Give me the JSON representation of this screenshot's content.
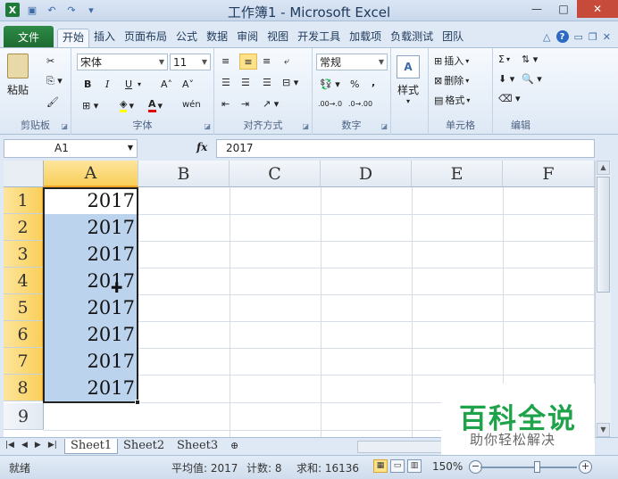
{
  "window": {
    "title": "工作簿1 - Microsoft Excel",
    "minimize": "—",
    "maximize": "□",
    "close": "✕"
  },
  "qat": {
    "app_icon": "X"
  },
  "ribbon_tabs": {
    "file": "文件",
    "items": [
      "开始",
      "插入",
      "页面布局",
      "公式",
      "数据",
      "审阅",
      "视图",
      "开发工具",
      "加载项",
      "负载测试",
      "团队"
    ],
    "help": "?"
  },
  "clipboard": {
    "paste": "粘贴",
    "label": "剪贴板"
  },
  "font": {
    "name": "宋体",
    "size": "11",
    "label": "字体",
    "bold": "B",
    "italic": "I",
    "underline": "U",
    "grow": "A˄",
    "shrink": "A˅",
    "phonetic": "wén"
  },
  "alignment": {
    "label": "对齐方式"
  },
  "number": {
    "format": "常规",
    "label": "数字",
    "percent": "%",
    "comma": ",",
    "inc_decimal": ".00→.0",
    "dec_decimal": ".0→.00"
  },
  "styles": {
    "label": "样式"
  },
  "cells": {
    "insert": "插入",
    "delete": "删除",
    "format": "格式",
    "label": "单元格"
  },
  "editing": {
    "label": "编辑",
    "sum": "Σ"
  },
  "formula_bar": {
    "name_box": "A1",
    "fx": "fx",
    "formula": "2017"
  },
  "grid": {
    "columns": [
      "A",
      "B",
      "C",
      "D",
      "E",
      "F"
    ],
    "rows": [
      "1",
      "2",
      "3",
      "4",
      "5",
      "6",
      "7",
      "8",
      "9"
    ],
    "a_values": [
      "2017",
      "2017",
      "2017",
      "2017",
      "2017",
      "2017",
      "2017",
      "2017",
      ""
    ]
  },
  "sheet_tabs": [
    "Sheet1",
    "Sheet2",
    "Sheet3"
  ],
  "watermark": {
    "main": "百科全说",
    "sub": "助你轻松解决"
  },
  "status": {
    "ready": "就绪",
    "average": "平均值: 2017",
    "count": "计数: 8",
    "sum": "求和: 16136",
    "zoom": "150%"
  }
}
